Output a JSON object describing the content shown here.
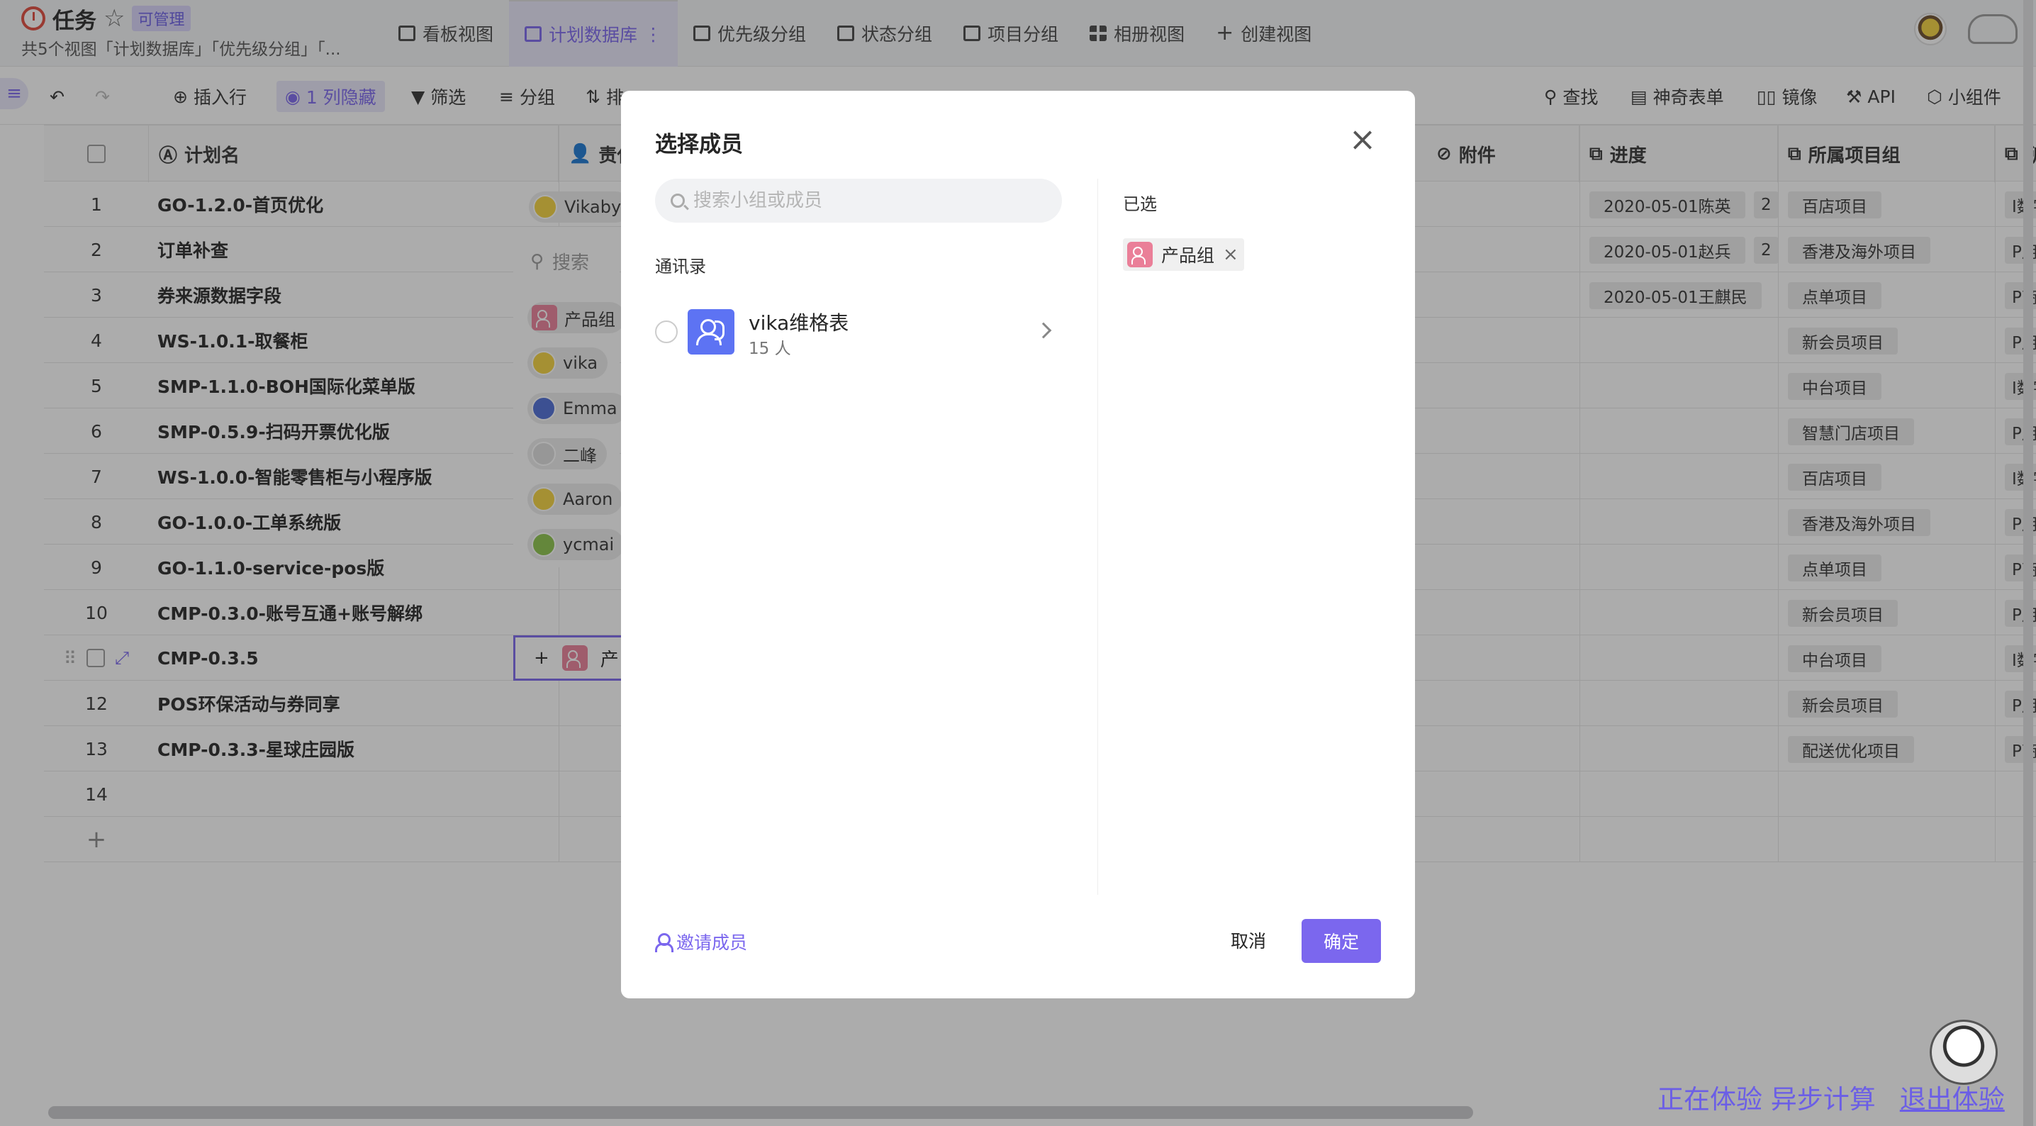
{
  "header": {
    "title": "任务",
    "badge": "可管理",
    "view_summary": "共5个视图「计划数据库」「优先级分组」「...",
    "tabs": [
      {
        "label": "看板视图",
        "icon": "kanban-icon"
      },
      {
        "label": "计划数据库",
        "icon": "grid-view-icon",
        "active": true
      },
      {
        "label": "优先级分组",
        "icon": "grid-view-icon"
      },
      {
        "label": "状态分组",
        "icon": "grid-view-icon"
      },
      {
        "label": "项目分组",
        "icon": "grid-view-icon"
      },
      {
        "label": "相册视图",
        "icon": "gallery-icon"
      },
      {
        "label": "创建视图",
        "icon": "plus-icon"
      }
    ]
  },
  "toolbar": {
    "insert_row": "插入行",
    "hidden_columns": "1 列隐藏",
    "filter": "筛选",
    "group": "分组",
    "sort_partial": "排",
    "find": "查找",
    "form": "神奇表单",
    "mirror": "镜像",
    "api": "API",
    "widgets": "小组件"
  },
  "grid": {
    "columns": [
      "计划名",
      "责任人",
      "附件",
      "进度",
      "所属项目组",
      "所属"
    ],
    "rows": [
      {
        "num": "1",
        "name": "GO-1.2.0-首页优化",
        "progress": "2020-05-01陈英",
        "progress2": "2",
        "project": "百店项目",
        "extra": "I数字协"
      },
      {
        "num": "2",
        "name": "订单补查",
        "progress": "2020-05-01赵兵",
        "progress2": "2",
        "project": "香港及海外项目",
        "extra": "P用户价"
      },
      {
        "num": "3",
        "name": "券来源数据字段",
        "progress": "2020-05-01王麒民",
        "progress2": "",
        "project": "点单项目",
        "extra": "P商业价"
      },
      {
        "num": "4",
        "name": "WS-1.0.1-取餐柜",
        "progress": "",
        "progress2": "",
        "project": "新会员项目",
        "extra": "P用户价"
      },
      {
        "num": "5",
        "name": "SMP-1.1.0-BOH国际化菜单版",
        "progress": "",
        "progress2": "",
        "project": "中台项目",
        "extra": "I数字协"
      },
      {
        "num": "6",
        "name": "SMP-0.5.9-扫码开票优化版",
        "progress": "",
        "progress2": "",
        "project": "智慧门店项目",
        "extra": "P用户价"
      },
      {
        "num": "7",
        "name": "WS-1.0.0-智能零售柜与小程序版",
        "progress": "",
        "progress2": "",
        "project": "百店项目",
        "extra": "I数字协"
      },
      {
        "num": "8",
        "name": "GO-1.0.0-工单系统版",
        "progress": "",
        "progress2": "",
        "project": "香港及海外项目",
        "extra": "P用户价"
      },
      {
        "num": "9",
        "name": "GO-1.1.0-service-pos版",
        "progress": "",
        "progress2": "",
        "project": "点单项目",
        "extra": "P商业价"
      },
      {
        "num": "10",
        "name": "CMP-0.3.0-账号互通+账号解绑",
        "progress": "",
        "progress2": "",
        "project": "新会员项目",
        "extra": "P用户价"
      },
      {
        "num": "",
        "name": "CMP-0.3.5",
        "progress": "",
        "progress2": "",
        "project": "中台项目",
        "extra": "I数字协"
      },
      {
        "num": "12",
        "name": "POS环保活动与券同享",
        "progress": "",
        "progress2": "",
        "project": "新会员项目",
        "extra": "P用户价"
      },
      {
        "num": "13",
        "name": "CMP-0.3.3-星球庄园版",
        "progress": "",
        "progress2": "",
        "project": "配送优化项目",
        "extra": "P商业价"
      },
      {
        "num": "14",
        "name": "",
        "progress": "",
        "progress2": "",
        "project": "",
        "extra": ""
      }
    ],
    "add_row": "+"
  },
  "member_panel": {
    "owner_row1": "Vikaby",
    "search": "搜索",
    "members": [
      "产品组",
      "vika",
      "Emma",
      "二峰",
      "Aaron",
      "ycmai"
    ],
    "selected_partial": "产"
  },
  "modal": {
    "title": "选择成员",
    "search_placeholder": "搜索小组或成员",
    "contacts_label": "通讯录",
    "contact_name": "vika维格表",
    "contact_count": "15 人",
    "selected_label": "已选",
    "selected_chip": "产品组",
    "invite": "邀请成员",
    "cancel": "取消",
    "confirm": "确定"
  },
  "footer": {
    "trial_text": "正在体验 异步计算",
    "exit_text": "退出体验"
  },
  "colors": {
    "accent": "#7b67ee",
    "team_icon": "#5d73f3",
    "group_icon": "#ea7f98"
  }
}
